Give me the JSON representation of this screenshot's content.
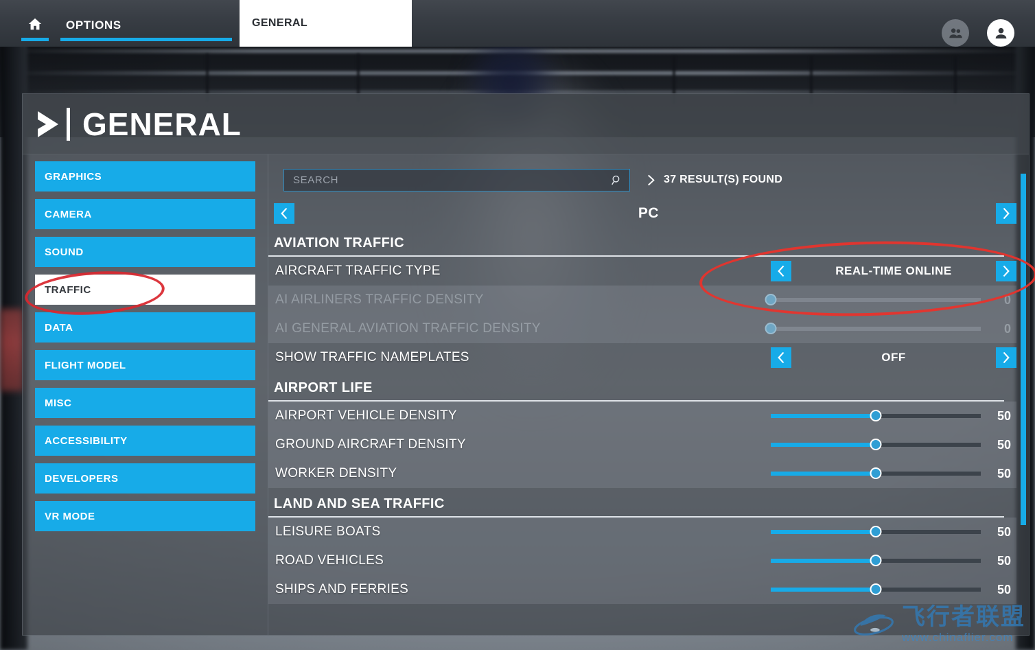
{
  "topbar": {
    "home_icon": "home-icon",
    "options_label": "OPTIONS",
    "active_tab_label": "GENERAL",
    "friends_icon": "friends-icon",
    "profile_icon": "profile-icon"
  },
  "page": {
    "chevron_icon": "chevron-right-icon",
    "title": "GENERAL"
  },
  "sidebar": {
    "items": [
      {
        "label": "GRAPHICS",
        "active": false
      },
      {
        "label": "CAMERA",
        "active": false
      },
      {
        "label": "SOUND",
        "active": false
      },
      {
        "label": "TRAFFIC",
        "active": true
      },
      {
        "label": "DATA",
        "active": false
      },
      {
        "label": "FLIGHT MODEL",
        "active": false
      },
      {
        "label": "MISC",
        "active": false
      },
      {
        "label": "ACCESSIBILITY",
        "active": false
      },
      {
        "label": "DEVELOPERS",
        "active": false
      },
      {
        "label": "VR MODE",
        "active": false
      }
    ]
  },
  "search": {
    "value": "",
    "placeholder": "SEARCH",
    "icon": "search-icon",
    "results_icon": "chevron-right-icon",
    "results_text": "37 RESULT(S) FOUND"
  },
  "platform": {
    "prev_icon": "chevron-left-icon",
    "name": "PC",
    "next_icon": "chevron-right-icon"
  },
  "sections": [
    {
      "title": "AVIATION TRAFFIC",
      "rows": [
        {
          "label": "AIRCRAFT TRAFFIC TYPE",
          "type": "spinner",
          "value": "REAL-TIME ONLINE",
          "disabled": false,
          "stripe": false,
          "prev_icon": "chevron-left-icon",
          "next_icon": "chevron-right-icon"
        },
        {
          "label": "AI AIRLINERS TRAFFIC DENSITY",
          "type": "slider",
          "value": "0",
          "percent": 0,
          "disabled": true,
          "stripe": true
        },
        {
          "label": "AI GENERAL AVIATION TRAFFIC DENSITY",
          "type": "slider",
          "value": "0",
          "percent": 0,
          "disabled": true,
          "stripe": true
        },
        {
          "label": "SHOW TRAFFIC NAMEPLATES",
          "type": "spinner",
          "value": "OFF",
          "disabled": false,
          "stripe": false,
          "prev_icon": "chevron-left-icon",
          "next_icon": "chevron-right-icon"
        }
      ]
    },
    {
      "title": "AIRPORT LIFE",
      "rows": [
        {
          "label": "AIRPORT VEHICLE DENSITY",
          "type": "slider",
          "value": "50",
          "percent": 50,
          "disabled": false,
          "stripe": true
        },
        {
          "label": "GROUND AIRCRAFT DENSITY",
          "type": "slider",
          "value": "50",
          "percent": 50,
          "disabled": false,
          "stripe": true
        },
        {
          "label": "WORKER DENSITY",
          "type": "slider",
          "value": "50",
          "percent": 50,
          "disabled": false,
          "stripe": true
        }
      ]
    },
    {
      "title": "LAND AND SEA TRAFFIC",
      "rows": [
        {
          "label": "LEISURE BOATS",
          "type": "slider",
          "value": "50",
          "percent": 50,
          "disabled": false,
          "stripe": true
        },
        {
          "label": "ROAD VEHICLES",
          "type": "slider",
          "value": "50",
          "percent": 50,
          "disabled": false,
          "stripe": true
        },
        {
          "label": "SHIPS AND FERRIES",
          "type": "slider",
          "value": "50",
          "percent": 50,
          "disabled": false,
          "stripe": true
        }
      ]
    }
  ],
  "annotations": [
    {
      "name": "sidebar-traffic-highlight",
      "shape": "ellipse",
      "color": "#d9282f"
    },
    {
      "name": "aircraft-traffic-type-highlight",
      "shape": "ellipse",
      "color": "#e8332c"
    }
  ],
  "watermark": {
    "text_cn": "飞行者联盟",
    "url": "www.chinaflier.com",
    "color": "#2f7fc1"
  },
  "colors": {
    "accent_blue": "#17abe8",
    "panel_bg": "#3e4349",
    "annotation_red": "#e8332c"
  }
}
